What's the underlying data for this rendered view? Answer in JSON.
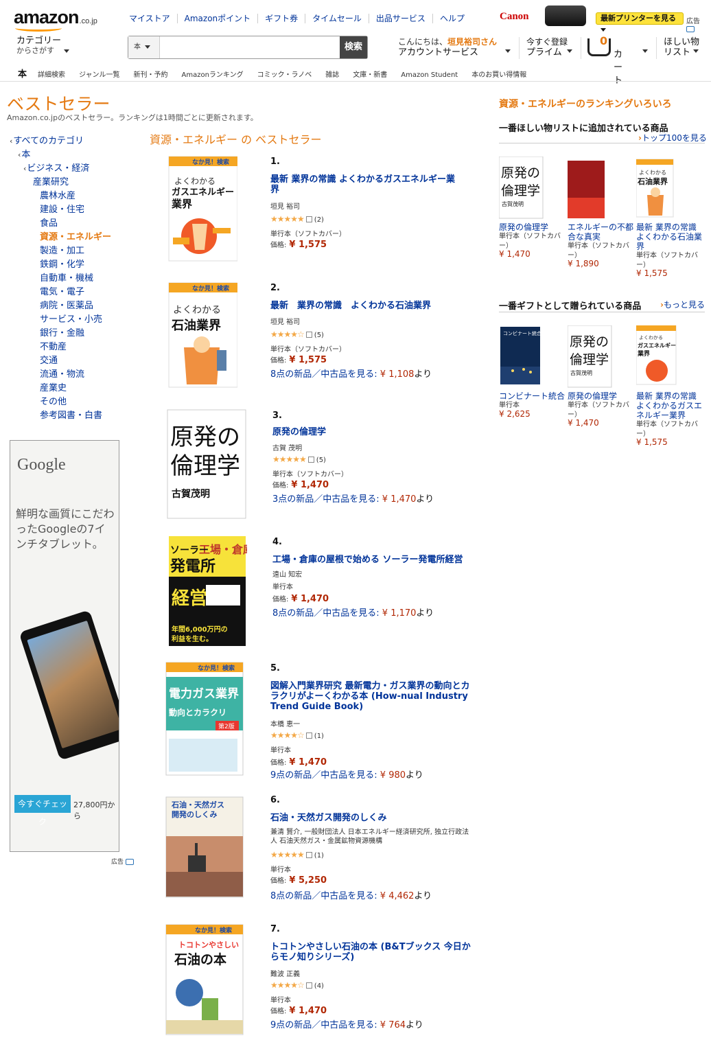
{
  "header": {
    "logo": "amazon",
    "logo_suffix": ".co.jp",
    "top_links": [
      "マイストア",
      "Amazonポイント",
      "ギフト券",
      "タイムセール",
      "出品サービス",
      "ヘルプ"
    ],
    "ad": {
      "brand": "Canon",
      "button": "最新プリンターを見る",
      "label": "広告"
    },
    "category_dropdown": {
      "line1": "カテゴリー",
      "line2": "からさがす"
    },
    "search": {
      "scope": "本",
      "placeholder": "",
      "button": "検索"
    },
    "account": {
      "greeting": "こんにちは、",
      "name": "垣見裕司さん",
      "label": "アカウントサービス"
    },
    "prime": {
      "small": "今すぐ登録",
      "big": "プライム"
    },
    "cart": {
      "count": "0",
      "label": "カート"
    },
    "wishlist": {
      "line1": "ほしい物",
      "line2": "リスト"
    },
    "subnav": [
      "本",
      "詳細検索",
      "ジャンル一覧",
      "新刊・予約",
      "Amazonランキング",
      "コミック・ラノベ",
      "雑誌",
      "文庫・新書",
      "Amazon Student",
      "本のお買い得情報"
    ]
  },
  "page": {
    "title": "ベストセラー",
    "subtitle": "Amazon.co.jpのベストセラー。ランキングは1時間ごとに更新されます。"
  },
  "leftnav": [
    {
      "label": "すべてのカテゴリ",
      "chevron": true
    },
    {
      "label": "本",
      "chevron": true
    },
    {
      "label": "ビジネス・経済",
      "chevron": true
    },
    {
      "label": "産業研究",
      "chevron": false
    },
    {
      "label": "農林水産"
    },
    {
      "label": "建設・住宅"
    },
    {
      "label": "食品"
    },
    {
      "label": "資源・エネルギー",
      "selected": true
    },
    {
      "label": "製造・加工"
    },
    {
      "label": "鉄鋼・化学"
    },
    {
      "label": "自動車・機械"
    },
    {
      "label": "電気・電子"
    },
    {
      "label": "病院・医薬品"
    },
    {
      "label": "サービス・小売"
    },
    {
      "label": "銀行・金融"
    },
    {
      "label": "不動産"
    },
    {
      "label": "交通"
    },
    {
      "label": "流通・物流"
    },
    {
      "label": "産業史"
    },
    {
      "label": "その他"
    },
    {
      "label": "参考図書・白書"
    }
  ],
  "google_ad": {
    "logo": "Google",
    "copy": "鮮明な画質にこだわったGoogleの7インチタブレット。",
    "button": "今すぐチェック",
    "price": "27,800円から",
    "label": "広告"
  },
  "center": {
    "heading": "資源・エネルギー の ベストセラー",
    "items": [
      {
        "rank": "1.",
        "title": "最新 業界の常識 よくわかるガスエネルギー業界",
        "author": "垣見 裕司",
        "stars": "★★★★★",
        "reviews": "(2)",
        "binding": "単行本（ソフトカバー）",
        "price_label": "価格:",
        "price": "¥ 1,575",
        "offers": "",
        "offers_price": "",
        "offers_suffix": ""
      },
      {
        "rank": "2.",
        "title": "最新　業界の常識　よくわかる石油業界",
        "author": "垣見 裕司",
        "stars": "★★★★☆",
        "reviews": "(5)",
        "binding": "単行本（ソフトカバー）",
        "price_label": "価格:",
        "price": "¥ 1,575",
        "offers": "8点の新品／中古品を見る:",
        "offers_price": "¥ 1,108",
        "offers_suffix": "より"
      },
      {
        "rank": "3.",
        "title": "原発の倫理学",
        "author": "古賀 茂明",
        "stars": "★★★★★",
        "reviews": "(5)",
        "binding": "単行本（ソフトカバー）",
        "price_label": "価格:",
        "price": "¥ 1,470",
        "offers": "3点の新品／中古品を見る:",
        "offers_price": "¥ 1,470",
        "offers_suffix": "より"
      },
      {
        "rank": "4.",
        "title": "工場・倉庫の屋根で始める ソーラー発電所経営",
        "author": "遠山 知宏",
        "stars": "",
        "reviews": "",
        "binding": "単行本",
        "price_label": "価格:",
        "price": "¥ 1,470",
        "offers": "8点の新品／中古品を見る:",
        "offers_price": "¥ 1,170",
        "offers_suffix": "より"
      },
      {
        "rank": "5.",
        "title": "図解入門業界研究 最新電力・ガス業界の動向とカラクリがよーくわかる本 (How-nual Industry Trend Guide Book)",
        "author": "本橋 恵一",
        "stars": "★★★★☆",
        "reviews": "(1)",
        "binding": "単行本",
        "price_label": "価格:",
        "price": "¥ 1,470",
        "offers": "9点の新品／中古品を見る:",
        "offers_price": "¥ 980",
        "offers_suffix": "より"
      },
      {
        "rank": "6.",
        "title": "石油・天然ガス開発のしくみ",
        "author": "兼清 賢介, 一般財団法人 日本エネルギー経済研究所, 独立行政法人 石油天然ガス・金属鉱物資源機構",
        "stars": "★★★★★",
        "reviews": "(1)",
        "binding": "単行本",
        "price_label": "価格:",
        "price": "¥ 5,250",
        "offers": "8点の新品／中古品を見る:",
        "offers_price": "¥ 4,462",
        "offers_suffix": "より"
      },
      {
        "rank": "7.",
        "title": "トコトンやさしい石油の本 (B&Tブックス 今日からモノ知りシリーズ)",
        "author": "難波 正義",
        "stars": "★★★★☆",
        "reviews": "(4)",
        "binding": "単行本",
        "price_label": "価格:",
        "price": "¥ 1,470",
        "offers": "9点の新品／中古品を見る:",
        "offers_price": "¥ 764",
        "offers_suffix": "より"
      }
    ]
  },
  "covers": {
    "c1": {
      "badge": "なか見！検索",
      "l1": "よくわかる",
      "l2": "ガスエネルギー",
      "l3": "業界"
    },
    "c2": {
      "badge": "なか見！検索",
      "l1": "よくわかる",
      "l2": "石油業界"
    },
    "c3": {
      "l1": "原発の",
      "l2": "倫理学",
      "l3": "古賀茂明"
    },
    "c4": {
      "l1": "工場・倉庫",
      "l2": "ソーラー",
      "l3": "発電所",
      "l4": "経営",
      "l5": "年間6,000万円の",
      "l6": "利益を生む。"
    },
    "c5": {
      "badge": "なか見！検索",
      "l1": "電力ガス業界",
      "l2": "動向とカラクリ",
      "l3": "第2版"
    },
    "c6": {
      "l1": "石油・天然ガス",
      "l2": "開発のしくみ"
    },
    "c7": {
      "badge": "なか見！検索",
      "l1": "トコトンやさしい",
      "l2": "石油の本"
    },
    "r1": {
      "l1": "原発の",
      "l2": "倫理学",
      "l3": "古賀茂明"
    },
    "r3": {
      "l1": "よくわかる",
      "l2": "石油業界"
    },
    "g1": {
      "l1": "コンビナート統合"
    },
    "g3": {
      "l1": "よくわかる",
      "l2": "ガスエネルギー",
      "l3": "業界"
    }
  },
  "right": {
    "title": "資源・エネルギーのランキングいろいろ",
    "wishlist_section": {
      "heading": "一番ほしい物リストに追加されている商品",
      "more": "トップ100を見る",
      "products": [
        {
          "title": "原発の倫理学",
          "binding": "単行本（ソフトカバー）",
          "price": "¥ 1,470"
        },
        {
          "title": "エネルギーの不都合な真実",
          "binding": "単行本（ソフトカバー）",
          "price": "¥ 1,890"
        },
        {
          "title": "最新 業界の常識 よくわかる石油業界",
          "binding": "単行本（ソフトカバー）",
          "price": "¥ 1,575"
        }
      ]
    },
    "gift_section": {
      "heading": "一番ギフトとして贈られている商品",
      "more": "もっと見る",
      "products": [
        {
          "title": "コンビナート統合",
          "binding": "単行本",
          "price": "¥ 2,625"
        },
        {
          "title": "原発の倫理学",
          "binding": "単行本（ソフトカバー）",
          "price": "¥ 1,470"
        },
        {
          "title": "最新 業界の常識 よくわかるガスエネルギー業界",
          "binding": "単行本（ソフトカバー）",
          "price": "¥ 1,575"
        }
      ]
    }
  },
  "colors": {
    "accent": "#e47911",
    "link": "#003399",
    "price": "#b12704",
    "star": "#f3a847"
  }
}
